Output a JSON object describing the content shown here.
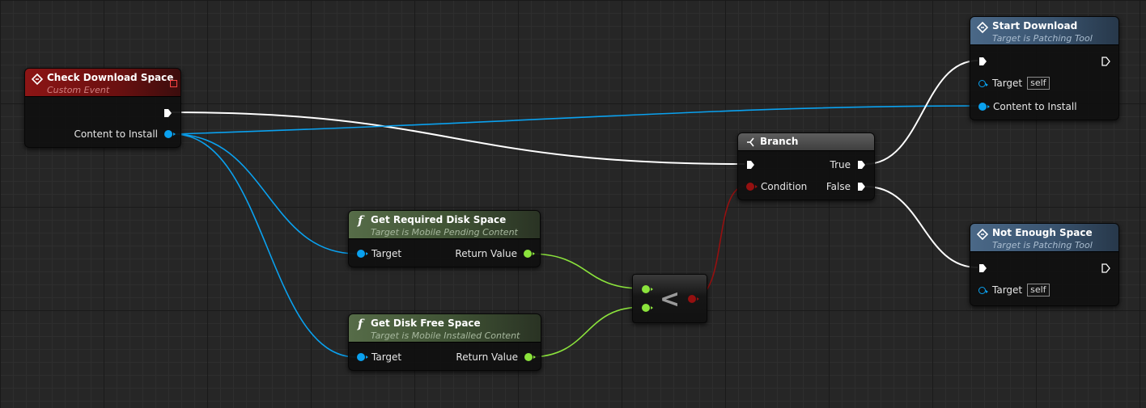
{
  "nodes": {
    "check_download_space": {
      "title": "Check Download Space",
      "subtitle": "Custom Event",
      "pins": {
        "content_to_install": "Content to Install"
      }
    },
    "start_download": {
      "title": "Start Download",
      "subtitle": "Target is Patching Tool",
      "pins": {
        "target": "Target",
        "target_default": "self",
        "content_to_install": "Content to Install"
      }
    },
    "branch": {
      "title": "Branch",
      "pins": {
        "condition": "Condition",
        "true": "True",
        "false": "False"
      }
    },
    "get_required_disk_space": {
      "title": "Get Required Disk Space",
      "subtitle": "Target is Mobile Pending Content",
      "pins": {
        "target": "Target",
        "return_value": "Return Value"
      }
    },
    "get_disk_free_space": {
      "title": "Get Disk Free Space",
      "subtitle": "Target is Mobile Installed Content",
      "pins": {
        "target": "Target",
        "return_value": "Return Value"
      }
    },
    "compare": {
      "symbol": "<"
    },
    "not_enough_space": {
      "title": "Not Enough Space",
      "subtitle": "Target is Patching Tool",
      "pins": {
        "target": "Target",
        "target_default": "self"
      }
    }
  },
  "icons": {
    "event": "diamond-event-icon",
    "function": "f-function-icon",
    "branch": "branch-icon",
    "exec": "exec-pin-arrow",
    "data": "data-pin-dot"
  },
  "colors": {
    "exec_wire": "#ffffff",
    "object_wire": "#0aa1ef",
    "float_wire": "#8be33c",
    "bool_wire": "#951010",
    "event_header": "#8c1515",
    "function_header": "#566c48",
    "call_header": "#4a6887"
  }
}
